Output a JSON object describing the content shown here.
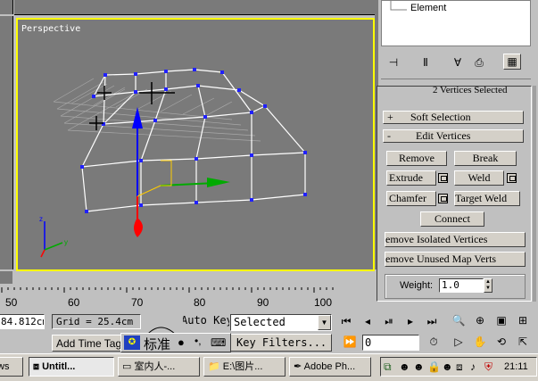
{
  "viewport": {
    "label": "Perspective"
  },
  "modifier_panel": {
    "element_label": "Element",
    "selection_info": "2 Vertices Selected",
    "rollouts": [
      {
        "sign": "+",
        "title": "Soft Selection"
      },
      {
        "sign": "-",
        "title": "Edit Vertices"
      }
    ],
    "buttons": {
      "remove": "Remove",
      "break": "Break",
      "extrude": "Extrude",
      "weld": "Weld",
      "chamfer": "Chamfer",
      "target_weld": "Target Weld",
      "connect": "Connect",
      "remove_isolated": "Remove Isolated Vertices",
      "remove_unused": "Remove Unused Map Verts"
    },
    "weight_label": "Weight:",
    "weight_value": "1.0"
  },
  "ruler": {
    "ticks": [
      "50",
      "60",
      "70",
      "80",
      "90",
      "100"
    ]
  },
  "status_bar": {
    "coord_value": "84.812cm",
    "grid_text": "Grid = 25.4cm",
    "auto_key": "Auto Key",
    "selected_option": "Selected",
    "add_time_tag": "Add Time Tag",
    "key_filters": "Key Filters...",
    "frame_value": "0"
  },
  "ime_bar": {
    "label": "标准"
  },
  "taskbar": {
    "items": [
      {
        "label": "Untitl..."
      },
      {
        "label": "室内人-..."
      },
      {
        "label": "E:\\图片..."
      },
      {
        "label": "Adobe Ph..."
      }
    ],
    "clock": "21:11"
  },
  "colors": {
    "viewport_bg": "#7a7a7a",
    "active_border": "#ffff00",
    "vertex": "#2020ff",
    "axis_x": "#ff0000",
    "axis_y": "#00aa00",
    "axis_z": "#0000ff"
  }
}
